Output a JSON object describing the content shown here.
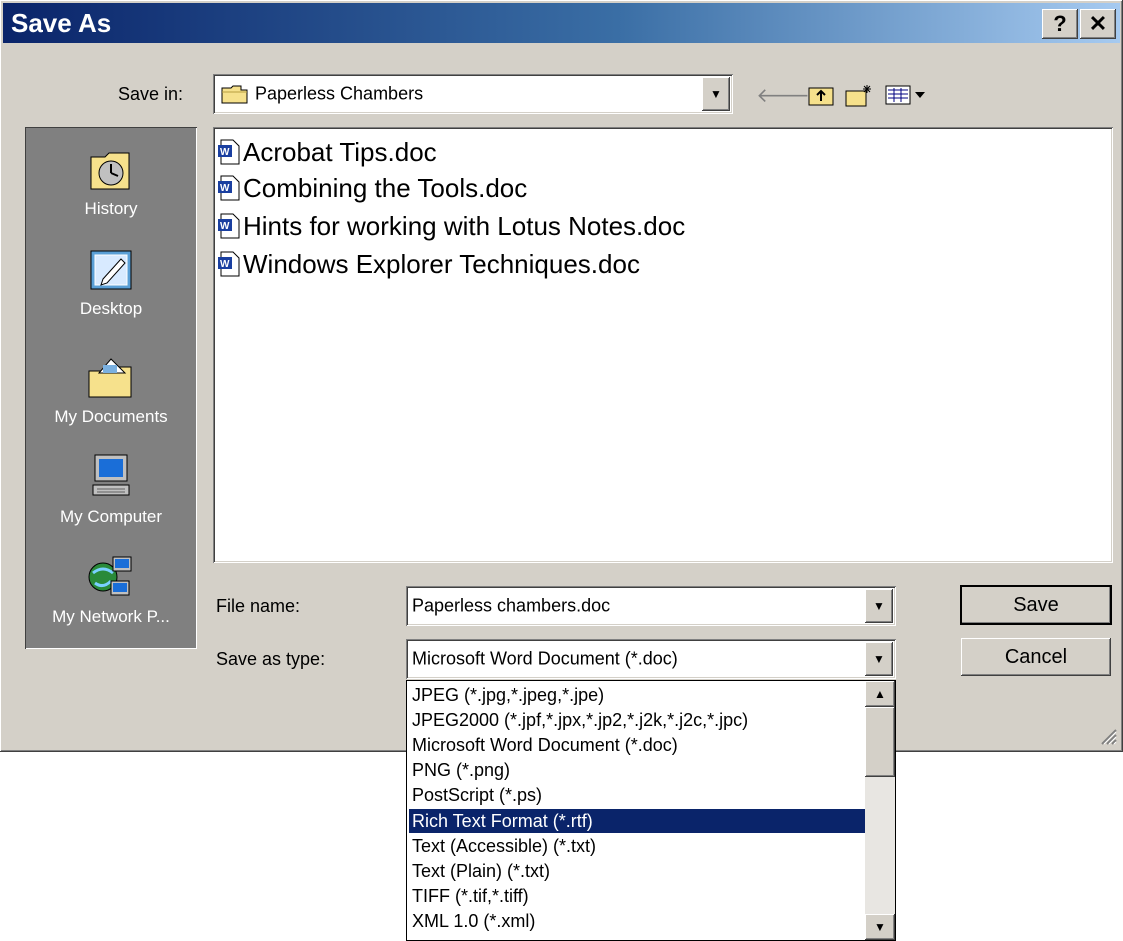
{
  "window": {
    "title": "Save As",
    "help_button": "?",
    "close_button": "✕"
  },
  "save_in": {
    "label": "Save in:",
    "value": "Paperless Chambers"
  },
  "toolbar": {
    "back_icon": "back-arrow-icon",
    "up_icon": "up-folder-icon",
    "new_folder_icon": "new-folder-icon",
    "views_icon": "views-menu-icon"
  },
  "places": [
    {
      "label": "History",
      "icon": "history-icon"
    },
    {
      "label": "Desktop",
      "icon": "desktop-icon"
    },
    {
      "label": "My Documents",
      "icon": "my-documents-icon"
    },
    {
      "label": "My Computer",
      "icon": "my-computer-icon"
    },
    {
      "label": "My Network P...",
      "icon": "my-network-places-icon"
    }
  ],
  "files": [
    "Acrobat Tips.doc",
    "Combining the Tools.doc",
    "Hints for working with Lotus Notes.doc",
    "Windows Explorer Techniques.doc"
  ],
  "file_name": {
    "label": "File name:",
    "value": "Paperless chambers.doc"
  },
  "save_as_type": {
    "label": "Save as type:",
    "value": "Microsoft Word Document (*.doc)",
    "options": [
      "JPEG (*.jpg,*.jpeg,*.jpe)",
      "JPEG2000 (*.jpf,*.jpx,*.jp2,*.j2k,*.j2c,*.jpc)",
      "Microsoft Word Document (*.doc)",
      "PNG (*.png)",
      "PostScript (*.ps)",
      "Rich Text Format (*.rtf)",
      "Text (Accessible) (*.txt)",
      "Text (Plain) (*.txt)",
      "TIFF (*.tif,*.tiff)",
      "XML 1.0 (*.xml)"
    ],
    "highlighted": "Rich Text Format (*.rtf)"
  },
  "buttons": {
    "save": "Save",
    "cancel": "Cancel"
  },
  "colors": {
    "title_start": "#0a246a",
    "title_end": "#a6caf0",
    "face": "#d4d0c8",
    "highlight": "#0a246a"
  }
}
